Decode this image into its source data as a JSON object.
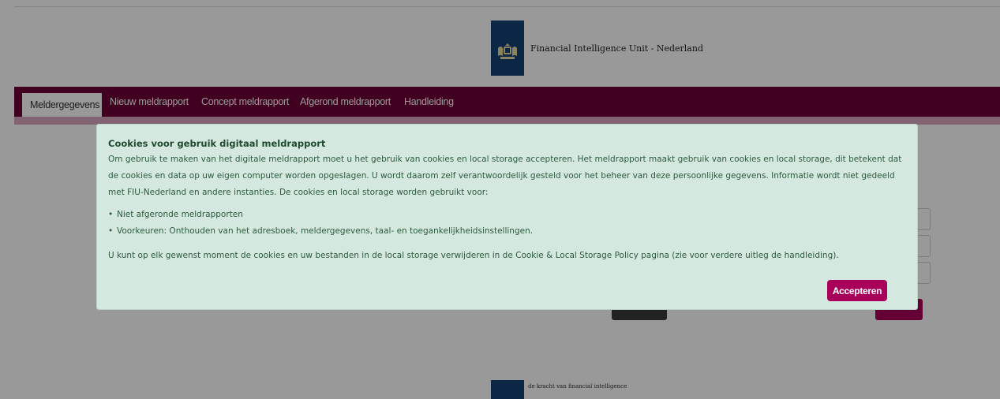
{
  "header": {
    "org_name": "Financial Intelligence Unit - Nederland",
    "logo_icon": "coat-of-arms-icon",
    "brand_color": "#154273"
  },
  "nav": {
    "items": [
      {
        "label": "Meldergegevens",
        "active": true
      },
      {
        "label": "Nieuw meldrapport",
        "active": false
      },
      {
        "label": "Concept meldrapport",
        "active": false
      },
      {
        "label": "Afgerond meldrapport",
        "active": false
      },
      {
        "label": "Handleiding",
        "active": false
      }
    ],
    "bar_color": "#6d0034"
  },
  "footer": {
    "tagline": "de kracht van financial intelligence"
  },
  "cookie_modal": {
    "title": "Cookies voor gebruik digitaal meldrapport",
    "intro": "Om gebruik te maken van het digitale meldrapport moet u het gebruik van cookies en local storage accepteren. Het meldrapport maakt gebruik van cookies en local storage, dit betekent dat de cookies en data op uw eigen computer worden opgeslagen. U wordt daarom zelf verantwoordelijk gesteld voor het beheer van deze persoonlijke gegevens. Informatie wordt niet gedeeld met FIU-Nederland en andere instanties. De cookies en local storage worden gebruikt voor:",
    "items": [
      "Niet afgeronde meldrapporten",
      "Voorkeuren: Onthouden van het adresboek, meldergegevens, taal- en toegankelijkheidsinstellingen."
    ],
    "outro": "U kunt op elk gewenst moment de cookies en uw bestanden in de local storage verwijderen in de Cookie & Local Storage Policy pagina (zie voor verdere uitleg de handleiding).",
    "accept_label": "Accepteren",
    "accent_color": "#a8005a",
    "background_color": "#d5e8df"
  }
}
